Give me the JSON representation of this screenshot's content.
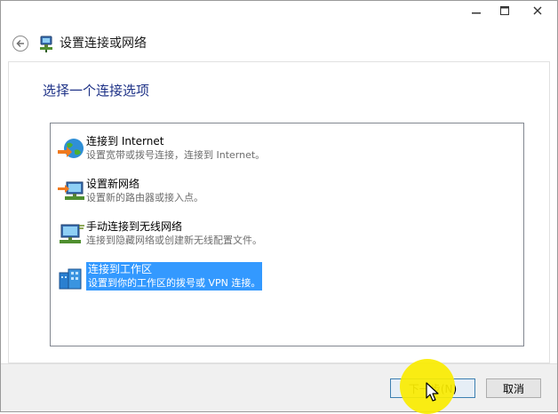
{
  "window": {
    "title": "设置连接或网络",
    "controls": {
      "minimize": "minimize-icon",
      "maximize": "maximize-icon",
      "close": "close-icon"
    }
  },
  "header": {
    "back_icon": "back-arrow-icon",
    "title": "设置连接或网络"
  },
  "instruction": "选择一个连接选项",
  "options": [
    {
      "title": "连接到 Internet",
      "desc": "设置宽带或拨号连接，连接到 Internet。",
      "icon": "internet-globe-icon",
      "selected": false
    },
    {
      "title": "设置新网络",
      "desc": "设置新的路由器或接入点。",
      "icon": "new-network-icon",
      "selected": false
    },
    {
      "title": "手动连接到无线网络",
      "desc": "连接到隐藏网络或创建新无线配置文件。",
      "icon": "wireless-network-icon",
      "selected": false
    },
    {
      "title": "连接到工作区",
      "desc": "设置到你的工作区的拨号或 VPN 连接。",
      "icon": "workplace-icon",
      "selected": true
    }
  ],
  "buttons": {
    "next": "下一步(N)",
    "cancel": "取消"
  },
  "colors": {
    "selection": "#3399ff",
    "instruction": "#1e3287",
    "highlight": "#faec00"
  }
}
